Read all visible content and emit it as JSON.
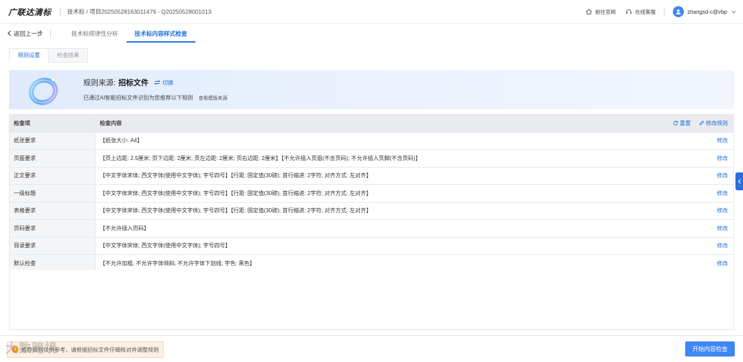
{
  "header": {
    "brand": "广联达清标",
    "breadcrumb": "技术标 / 项目20250528163011479 - Q20250528001013",
    "links": [
      {
        "label": "前往官网",
        "icon": "home-icon"
      },
      {
        "label": "在线客服",
        "icon": "headset-icon"
      }
    ],
    "user": "zhangsd-c@vbp"
  },
  "nav": {
    "back_label": "返回上一步",
    "tabs": [
      {
        "label": "技术标规律性分析",
        "active": false
      },
      {
        "label": "技术标内容样式检查",
        "active": true
      }
    ]
  },
  "subtabs": [
    {
      "label": "规则设置",
      "active": true
    },
    {
      "label": "检查结果",
      "active": false
    }
  ],
  "banner": {
    "source_label": "规则来源:",
    "source_value": "招标文件",
    "switch_label": "切换",
    "hint": "已通过AI智能招标文件识别为您推荐以下规则",
    "hint_link": "查看模版来源"
  },
  "table": {
    "headers": [
      "检查项",
      "检查内容"
    ],
    "reset_label": "重置",
    "modify_rules_label": "修改规则",
    "edit_label": "修改",
    "rows": [
      {
        "item": "纸张要求",
        "content": "【纸张大小: A4】"
      },
      {
        "item": "页面要求",
        "content": "【页上边距: 2.5厘米; 页下边距: 2厘米; 页左边距: 2厘米; 页右边距: 2厘米】【不允许插入页眉(不含页码); 不允许插入页脚(不含页码)】"
      },
      {
        "item": "正文要求",
        "content": "【中文字体宋体; 西文字体(使用中文字体); 字号四号】【行距: 固定值(30磅); 首行缩进: 2字符; 对齐方式: 左对齐】"
      },
      {
        "item": "一级标题",
        "content": "【中文字体宋体; 西文字体(使用中文字体); 字号四号】【行距: 固定值(30磅); 首行缩进: 2字符; 对齐方式: 左对齐】"
      },
      {
        "item": "表格要求",
        "content": "【中文字体宋体; 西文字体(使用中文字体); 字号四号】【行距: 固定值(30磅); 首行缩进: 2字符; 对齐方式: 左对齐】"
      },
      {
        "item": "页码要求",
        "content": "【不允许插入页码】"
      },
      {
        "item": "目录要求",
        "content": "【中文字体宋体; 西文字体(使用中文字体); 字号四号】"
      },
      {
        "item": "默认检查",
        "content": "【不允许加粗; 不允许字体倾斜; 不允许字体下划线; 字色: 黑色】"
      }
    ]
  },
  "footer": {
    "notice": "推荐规则仅供参考，请根据招标文件仔细核对并调整规则",
    "watermark": "大数跨境",
    "start_button": "开始内容检查"
  },
  "colors": {
    "accent": "#1f6fe0",
    "primary_button": "#3f87f5",
    "warning": "#f59a23"
  }
}
